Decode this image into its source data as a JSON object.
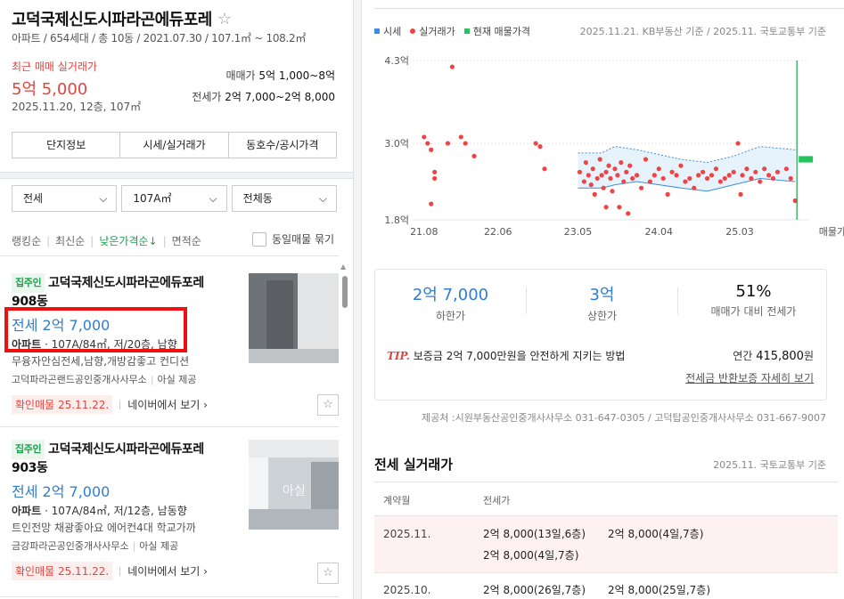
{
  "complex": {
    "name": "고덕국제신도시파라곤에듀포레",
    "meta": "아파트 / 654세대 / 총 10동 / 2021.07.30 / 107.1㎡ ~ 108.2㎡",
    "favorite_icon": "star-outline-icon"
  },
  "recent": {
    "label": "최근 매매 실거래가",
    "price": "5억 5,000",
    "date": "2025.11.20, 12층, 107㎡",
    "sale_label": "매매가",
    "sale_range": "5억 1,000~8억",
    "jeonse_label": "전세가",
    "jeonse_range": "2억 7,000~2억 8,000"
  },
  "tabs": [
    "단지정보",
    "시세/실거래가",
    "동호수/공시가격"
  ],
  "filters": [
    "전세",
    "107A㎡",
    "전체동"
  ],
  "sort": {
    "options": [
      "랭킹순",
      "최신순",
      "낮은가격순↓",
      "면적순"
    ],
    "active_index": 2,
    "dup_label": "동일매물 묶기"
  },
  "listings": [
    {
      "badge": "집주인",
      "title": "고덕국제신도시파라곤에듀포레 908동",
      "price": "전세 2억 7,000",
      "spec_type": "아파트",
      "spec": "107A/84㎡, 저/20층, 남향",
      "desc": "무융자안심전세,남향,개방감좋고 컨디션",
      "agent": "고덕파라곤랜드공인중개사사무소",
      "provider": "아실 제공",
      "confirm": "확인매물 25.11.22.",
      "naver": "네이버에서 보기 ›",
      "photo_text": ""
    },
    {
      "badge": "집주인",
      "title": "고덕국제신도시파라곤에듀포레 903동",
      "price": "전세 2억 7,000",
      "spec_type": "아파트",
      "spec": "107A/84㎡, 저/12층, 남동향",
      "desc": "트인전망 채광좋아요 에어컨4대 학교가까",
      "agent": "금강파라곤공인중개사사무소",
      "provider": "아실 제공",
      "confirm": "확인매물 25.11.22.",
      "naver": "네이버에서 보기 ›",
      "photo_text": "아실"
    }
  ],
  "chart_legend": [
    "시세",
    "실거래가",
    "현재 매물가격"
  ],
  "chart_source": "2025.11.21. KB부동산 기준 / 2025.11. 국토교통부 기준",
  "chart_data": {
    "type": "scatter",
    "y_ticks": [
      "4.3억",
      "3.0억",
      "1.8억"
    ],
    "ylim": [
      1.8,
      4.3
    ],
    "x_ticks": [
      "21.08",
      "22.06",
      "23.05",
      "24.04",
      "25.03",
      "매물가격"
    ],
    "x_ticks_value": [
      2021.58,
      2022.42,
      2023.33,
      2024.25,
      2025.17
    ],
    "xlim": [
      2021.45,
      2025.95
    ],
    "colors": {
      "actual": "#ef4444",
      "market": "#3b8ee0",
      "listing": "#22c55e",
      "current": "#16a34a"
    },
    "series": [
      {
        "name": "실거래가",
        "points": [
          [
            2021.58,
            3.1
          ],
          [
            2021.62,
            3.0
          ],
          [
            2021.66,
            2.9
          ],
          [
            2021.7,
            2.55
          ],
          [
            2021.7,
            2.45
          ],
          [
            2021.66,
            2.05
          ],
          [
            2021.85,
            3.0
          ],
          [
            2021.9,
            4.2
          ],
          [
            2022.0,
            3.1
          ],
          [
            2022.05,
            3.0
          ],
          [
            2022.15,
            2.8
          ],
          [
            2022.85,
            3.0
          ],
          [
            2022.9,
            2.95
          ],
          [
            2022.95,
            2.6
          ],
          [
            2023.35,
            2.55
          ],
          [
            2023.4,
            2.4
          ],
          [
            2023.42,
            2.7
          ],
          [
            2023.45,
            2.5
          ],
          [
            2023.48,
            2.35
          ],
          [
            2023.5,
            2.6
          ],
          [
            2023.52,
            2.2
          ],
          [
            2023.55,
            2.45
          ],
          [
            2023.58,
            2.75
          ],
          [
            2023.6,
            2.5
          ],
          [
            2023.62,
            2.3
          ],
          [
            2023.65,
            2.55
          ],
          [
            2023.65,
            2.0
          ],
          [
            2023.68,
            2.65
          ],
          [
            2023.7,
            2.45
          ],
          [
            2023.72,
            2.25
          ],
          [
            2023.75,
            2.6
          ],
          [
            2023.78,
            2.5
          ],
          [
            2023.8,
            2.0
          ],
          [
            2023.82,
            2.7
          ],
          [
            2023.85,
            2.4
          ],
          [
            2023.88,
            2.55
          ],
          [
            2023.9,
            1.9
          ],
          [
            2023.92,
            2.65
          ],
          [
            2023.95,
            2.45
          ],
          [
            2024.0,
            2.5
          ],
          [
            2024.05,
            2.3
          ],
          [
            2024.1,
            2.75
          ],
          [
            2024.15,
            2.4
          ],
          [
            2024.2,
            2.5
          ],
          [
            2024.25,
            2.6
          ],
          [
            2024.3,
            2.45
          ],
          [
            2024.35,
            2.2
          ],
          [
            2024.4,
            2.55
          ],
          [
            2024.45,
            2.5
          ],
          [
            2024.5,
            2.65
          ],
          [
            2024.55,
            2.4
          ],
          [
            2024.6,
            2.45
          ],
          [
            2024.65,
            2.3
          ],
          [
            2024.7,
            2.5
          ],
          [
            2024.75,
            2.55
          ],
          [
            2024.8,
            2.45
          ],
          [
            2024.85,
            2.5
          ],
          [
            2024.9,
            2.6
          ],
          [
            2024.95,
            2.4
          ],
          [
            2025.0,
            2.45
          ],
          [
            2025.05,
            2.5
          ],
          [
            2025.1,
            2.55
          ],
          [
            2025.15,
            3.0
          ],
          [
            2025.18,
            2.2
          ],
          [
            2025.2,
            2.5
          ],
          [
            2025.25,
            2.6
          ],
          [
            2025.3,
            2.45
          ],
          [
            2025.35,
            2.55
          ],
          [
            2025.4,
            2.4
          ],
          [
            2025.45,
            2.6
          ],
          [
            2025.5,
            2.5
          ],
          [
            2025.55,
            2.45
          ],
          [
            2025.6,
            2.55
          ],
          [
            2025.7,
            2.6
          ],
          [
            2025.75,
            2.45
          ],
          [
            2025.8,
            2.1
          ]
        ]
      },
      {
        "name": "시세",
        "upper": [
          [
            2023.33,
            2.85
          ],
          [
            2023.6,
            2.85
          ],
          [
            2023.75,
            2.95
          ],
          [
            2024.0,
            2.9
          ],
          [
            2024.5,
            2.75
          ],
          [
            2024.8,
            2.7
          ],
          [
            2025.1,
            2.8
          ],
          [
            2025.4,
            2.95
          ],
          [
            2025.8,
            2.9
          ]
        ],
        "lower": [
          [
            2023.33,
            2.3
          ],
          [
            2023.6,
            2.3
          ],
          [
            2023.75,
            2.35
          ],
          [
            2024.0,
            2.4
          ],
          [
            2024.5,
            2.3
          ],
          [
            2024.8,
            2.25
          ],
          [
            2025.1,
            2.35
          ],
          [
            2025.4,
            2.45
          ],
          [
            2025.8,
            2.4
          ]
        ]
      },
      {
        "name": "현재 매물가격",
        "range": [
          2.7,
          2.8
        ]
      }
    ],
    "current_marker_x": 2025.82
  },
  "summary": {
    "min_value": "2억 7,000",
    "min_label": "하한가",
    "max_value": "3억",
    "max_label": "상한가",
    "ratio_value": "51%",
    "ratio_label": "매매가 대비 전세가",
    "tip_label": "TIP.",
    "tip_text": "보증금 2억 7,000만원을 안전하게 지키는 방법",
    "annual_label": "연간",
    "annual_value": "415,800",
    "annual_unit": "원",
    "return_link": "전세금 반환보증 자세히 보기"
  },
  "provider_text": "제공처 :시원부동산공인중개사사무소 031-647-0305 / 고덕탑공인중개사사무소 031-667-9007",
  "trades": {
    "title": "전세 실거래가",
    "source": "2025.11. 국토교통부 기준",
    "col_month": "계약월",
    "col_price": "전세가",
    "rows": [
      {
        "month": "2025.11.",
        "items": [
          "2억 8,000(13일,6층)",
          "2억 8,000(4일,7층)",
          "2억 8,000(4일,7층)"
        ]
      },
      {
        "month": "2025.10.",
        "items": [
          "2억 8,000(26일,7층)",
          "2억 8,000(25일,7층)"
        ]
      }
    ]
  }
}
